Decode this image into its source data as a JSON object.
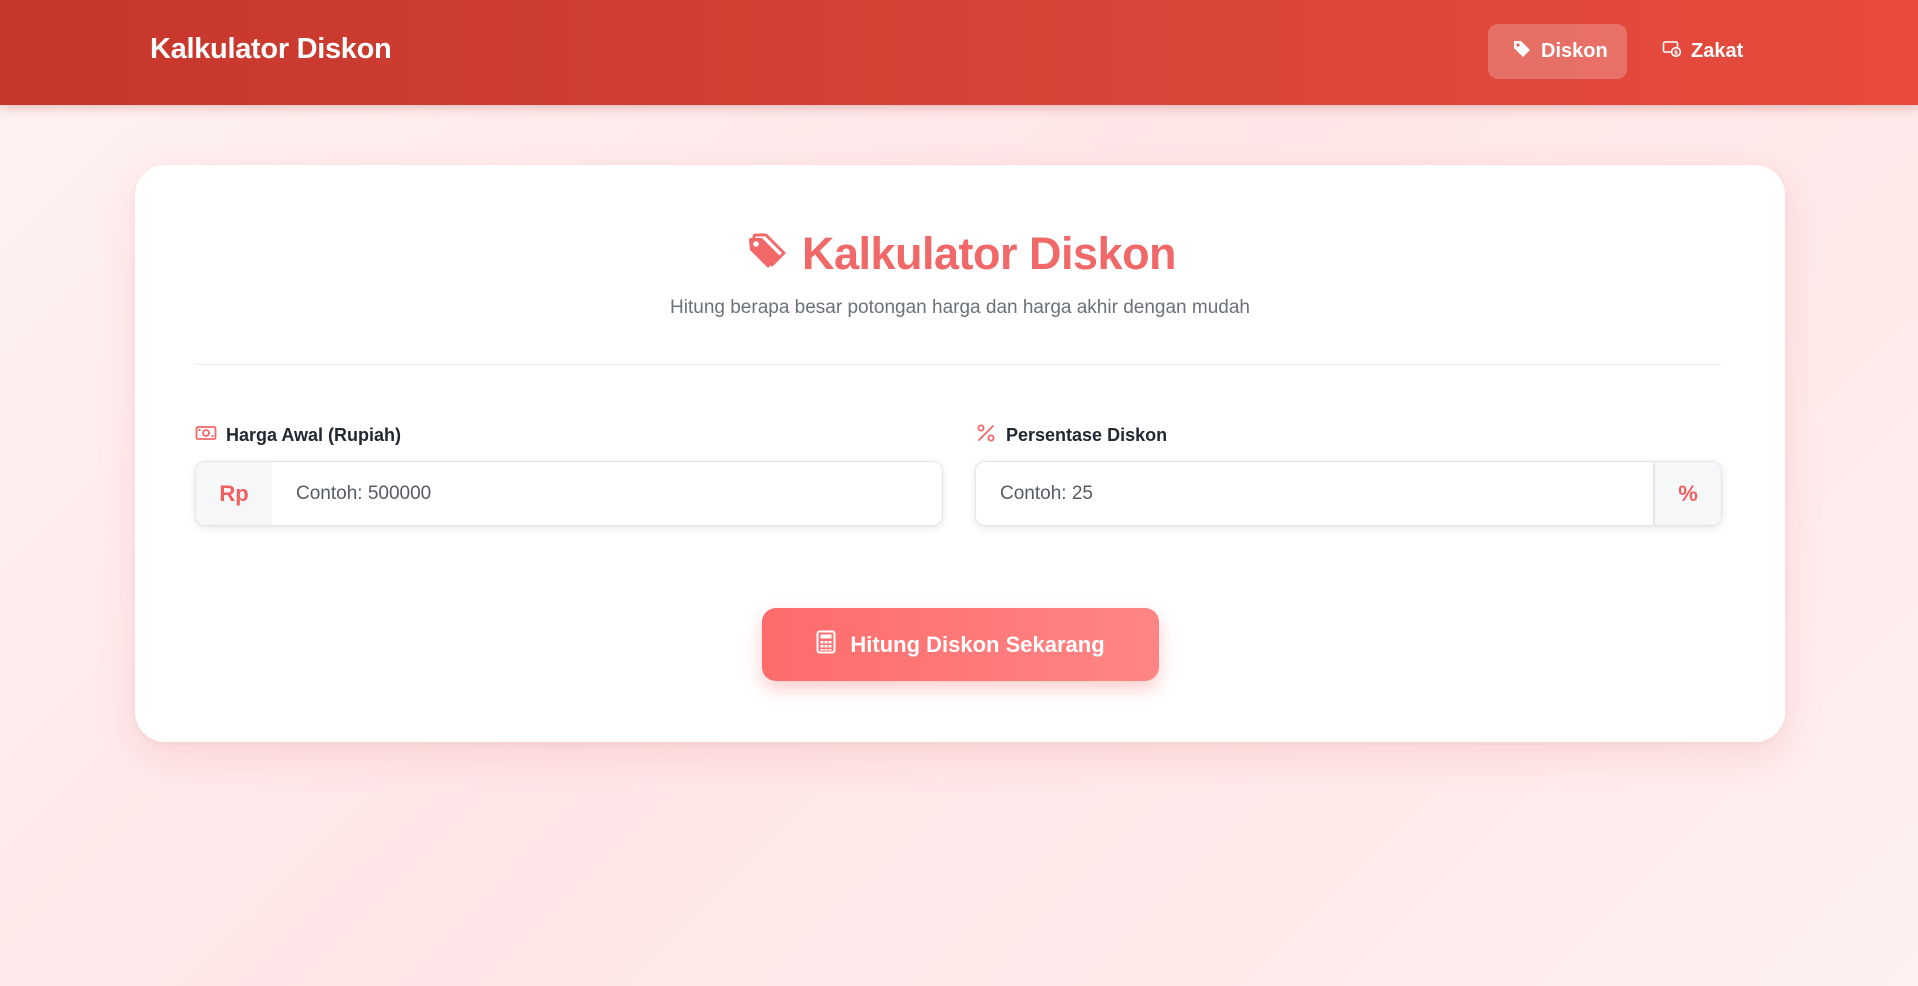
{
  "navbar": {
    "brand": "Kalkulator Diskon",
    "items": [
      {
        "label": "Diskon",
        "icon": "tag-icon",
        "active": true
      },
      {
        "label": "Zakat",
        "icon": "money-coin-icon",
        "active": false
      }
    ]
  },
  "calculator": {
    "title": "Kalkulator Diskon",
    "title_icon": "tags-icon",
    "subtitle": "Hitung berapa besar potongan harga dan harga akhir dengan mudah",
    "price_field": {
      "label": "Harga Awal (Rupiah)",
      "icon": "money-bill-icon",
      "prefix": "Rp",
      "placeholder": "Contoh: 500000",
      "value": ""
    },
    "discount_field": {
      "label": "Persentase Diskon",
      "icon": "percent-icon",
      "suffix": "%",
      "placeholder": "Contoh: 25",
      "value": ""
    },
    "submit_label": "Hitung Diskon Sekarang",
    "submit_icon": "calculator-icon"
  },
  "colors": {
    "navbar_start": "#c5362b",
    "navbar_end": "#e84b3d",
    "accent": "#f06868",
    "button_start": "#ff6b6b",
    "button_end": "#ff8585"
  }
}
